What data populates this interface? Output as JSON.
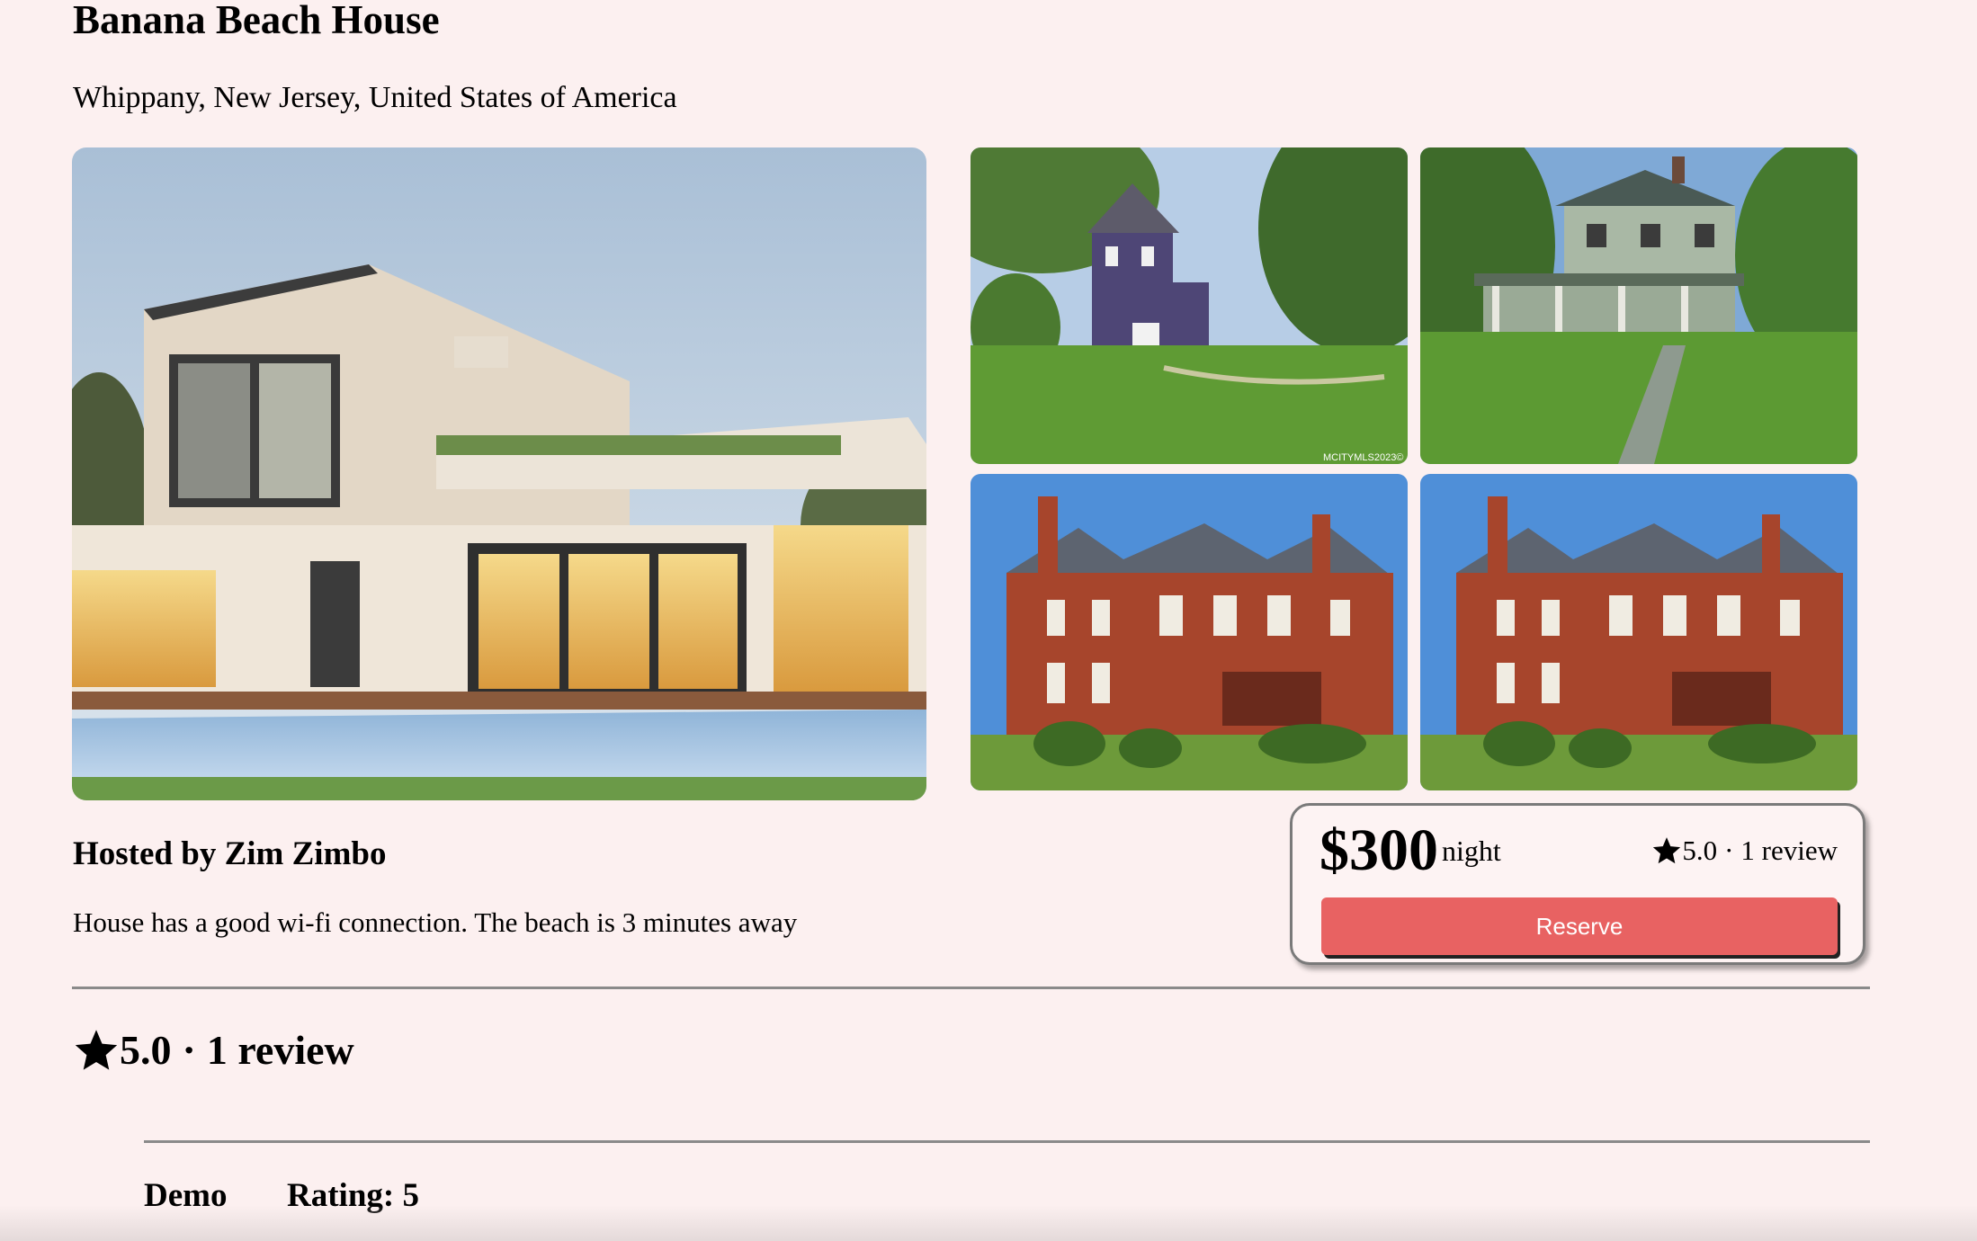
{
  "listing": {
    "title": "Banana Beach House",
    "location": "Whippany, New Jersey, United States of America",
    "host_prefix": "Hosted by",
    "host_name": "Zim Zimbo",
    "description": "House has a good wi-fi connection. The beach is 3 minutes away"
  },
  "gallery": {
    "main_alt": "modern house with pool",
    "tiles": [
      {
        "alt": "purple farmhouse",
        "watermark": "MCITYMLS2023©"
      },
      {
        "alt": "green victorian house with porch"
      },
      {
        "alt": "red brick mansion"
      },
      {
        "alt": "red brick mansion"
      }
    ]
  },
  "booking": {
    "price": "$300",
    "unit": "night",
    "rating": "5.0",
    "separator": "·",
    "review_count": "1 review",
    "reserve_label": "Reserve",
    "button_color": "#e86262"
  },
  "reviews": {
    "rating": "5.0",
    "separator": "·",
    "review_count": "1 review",
    "items": [
      {
        "author": "Demo",
        "rating_label": "Rating: 5"
      }
    ]
  },
  "icons": {
    "rating": "star-icon"
  }
}
